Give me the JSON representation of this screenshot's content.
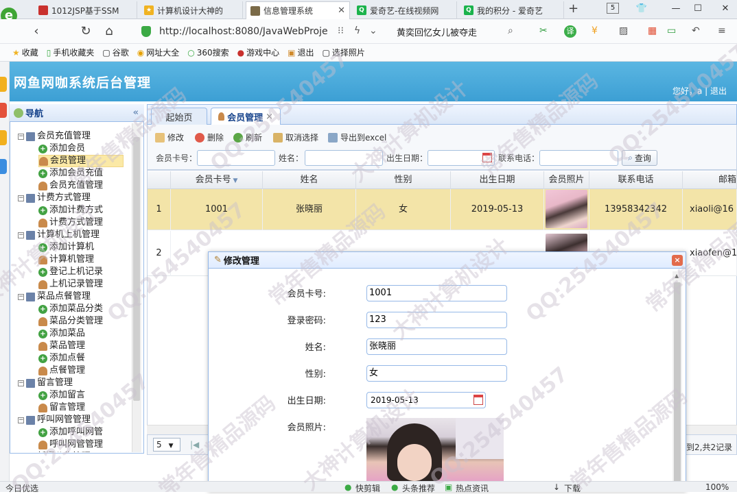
{
  "browser": {
    "tabs": [
      {
        "label": "1012JSP基于SSM",
        "active": false
      },
      {
        "label": "计算机设计大神的",
        "active": false
      },
      {
        "label": "信息管理系统",
        "active": true
      },
      {
        "label": "爱奇艺-在线视频网",
        "active": false
      },
      {
        "label": "我的积分 - 爱奇艺",
        "active": false
      }
    ],
    "new_tab": "+",
    "tab_count": "5",
    "url": "http://localhost:8080/JavaWebProje",
    "search_suggest": "黄奕回忆女儿被夺走",
    "bookmarks": [
      "收藏",
      "手机收藏夹",
      "谷歌",
      "网址大全",
      "360搜索",
      "游戏中心",
      "退出",
      "选择照片"
    ],
    "status": [
      "今日优选",
      "快剪辑",
      "头条推荐",
      "热点资讯",
      "下载",
      "100%"
    ]
  },
  "app": {
    "title": "网鱼网咖系统后台管理",
    "greeting": "您好，a | 退出"
  },
  "nav": {
    "title": "导航",
    "groups": [
      {
        "label": "会员充值管理",
        "items": [
          "添加会员",
          "会员管理",
          "添加会员充值",
          "会员充值管理"
        ]
      },
      {
        "label": "计费方式管理",
        "items": [
          "添加计费方式",
          "计费方式管理"
        ]
      },
      {
        "label": "计算机上机管理",
        "items": [
          "添加计算机",
          "计算机管理",
          "登记上机记录",
          "上机记录管理"
        ]
      },
      {
        "label": "菜品点餐管理",
        "items": [
          "添加菜品分类",
          "菜品分类管理",
          "添加菜品",
          "菜品管理",
          "添加点餐",
          "点餐管理"
        ]
      },
      {
        "label": "留言管理",
        "items": [
          "添加留言",
          "留言管理"
        ]
      },
      {
        "label": "呼叫网管管理",
        "items": [
          "添加呼叫网管",
          "呼叫网管管理"
        ]
      },
      {
        "label": "新闻公告管理",
        "items": []
      }
    ],
    "selected": "会员管理"
  },
  "content_tabs": [
    {
      "label": "起始页",
      "active": false
    },
    {
      "label": "会员管理",
      "active": true,
      "close": "×"
    }
  ],
  "toolbar": {
    "edit": "修改",
    "delete": "删除",
    "refresh": "刷新",
    "cancel_select": "取消选择",
    "export": "导出到excel"
  },
  "filters": {
    "card_no": "会员卡号：",
    "name": "姓名：",
    "birth": "出生日期：",
    "phone": "联系电话：",
    "search": "查询"
  },
  "grid": {
    "columns": [
      "会员卡号",
      "姓名",
      "性别",
      "出生日期",
      "会员照片",
      "联系电话",
      "邮箱"
    ],
    "rows": [
      {
        "index": "1",
        "card_no": "1001",
        "name": "张晓丽",
        "gender": "女",
        "birth": "2019-05-13",
        "phone": "13958342342",
        "email": "xiaoli@16"
      },
      {
        "index": "2",
        "card_no": "",
        "name": "",
        "gender": "",
        "birth": "",
        "phone": "",
        "email": "xiaofen@1"
      }
    ],
    "page_size": "5",
    "page_info": "到2,共2记录"
  },
  "dialog": {
    "title": "修改管理",
    "close": "×",
    "fields": [
      {
        "label": "会员卡号:",
        "value": "1001"
      },
      {
        "label": "登录密码:",
        "value": "123"
      },
      {
        "label": "姓名:",
        "value": "张晓丽"
      },
      {
        "label": "性别:",
        "value": "女"
      },
      {
        "label": "出生日期:",
        "value": "2019-05-13"
      },
      {
        "label": "会员照片:",
        "value": ""
      }
    ]
  },
  "watermark": {
    "lines": [
      "QQ:254540457",
      "常年售精品源码",
      "大神计算机设计"
    ]
  }
}
